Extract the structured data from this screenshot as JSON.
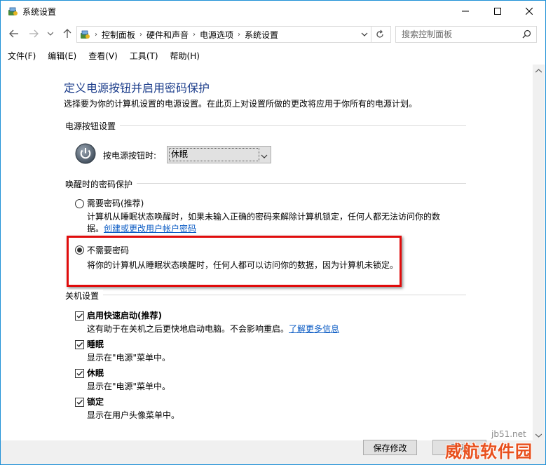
{
  "window": {
    "title": "系统设置"
  },
  "address": {
    "crumbs": [
      "控制面板",
      "硬件和声音",
      "电源选项",
      "系统设置"
    ],
    "search_placeholder": "搜索控制面板"
  },
  "menu": {
    "items": [
      "文件(F)",
      "编辑(E)",
      "查看(V)",
      "工具(T)",
      "帮助(H)"
    ]
  },
  "page": {
    "title": "定义电源按钮并启用密码保护",
    "description": "选择要为你的计算机设置的电源设置。在此页上对设置所做的更改将应用于你所有的电源计划。"
  },
  "power_button": {
    "section": "电源按钮设置",
    "label": "按电源按钮时:",
    "selected": "休眠"
  },
  "wake_password": {
    "section": "唤醒时的密码保护",
    "require": {
      "label": "需要密码(推荐)",
      "desc_line1": "计算机从睡眠状态唤醒时，如果未输入正确的密码来解除计算机锁定，任何人都无法访问你的数",
      "desc_line2": "据。",
      "link": "创建或更改用户帐户密码",
      "checked": false
    },
    "not_require": {
      "label": "不需要密码",
      "desc": "将你的计算机从睡眠状态唤醒时，任何人都可以访问你的数据，因为计算机未锁定。",
      "checked": true
    }
  },
  "shutdown": {
    "section": "关机设置",
    "items": [
      {
        "label": "启用快速启动(推荐)",
        "desc": "这有助于在关机之后更快地启动电脑。不会影响重启。",
        "link": "了解更多信息",
        "checked": true
      },
      {
        "label": "睡眠",
        "desc": "显示在\"电源\"菜单中。",
        "link": "",
        "checked": true
      },
      {
        "label": "休眠",
        "desc": "显示在\"电源\"菜单中。",
        "link": "",
        "checked": true
      },
      {
        "label": "锁定",
        "desc": "显示在用户头像菜单中。",
        "link": "",
        "checked": true
      }
    ]
  },
  "footer": {
    "save_label": "保存修改",
    "cancel_label": "取消"
  },
  "watermark": {
    "site": "jb51.net",
    "brand": "威航软件园"
  },
  "colors": {
    "title_blue": "#1e3f8c",
    "link_blue": "#0a5bc4",
    "highlight_red": "#e00c0c",
    "window_border": "#1e90d6"
  }
}
